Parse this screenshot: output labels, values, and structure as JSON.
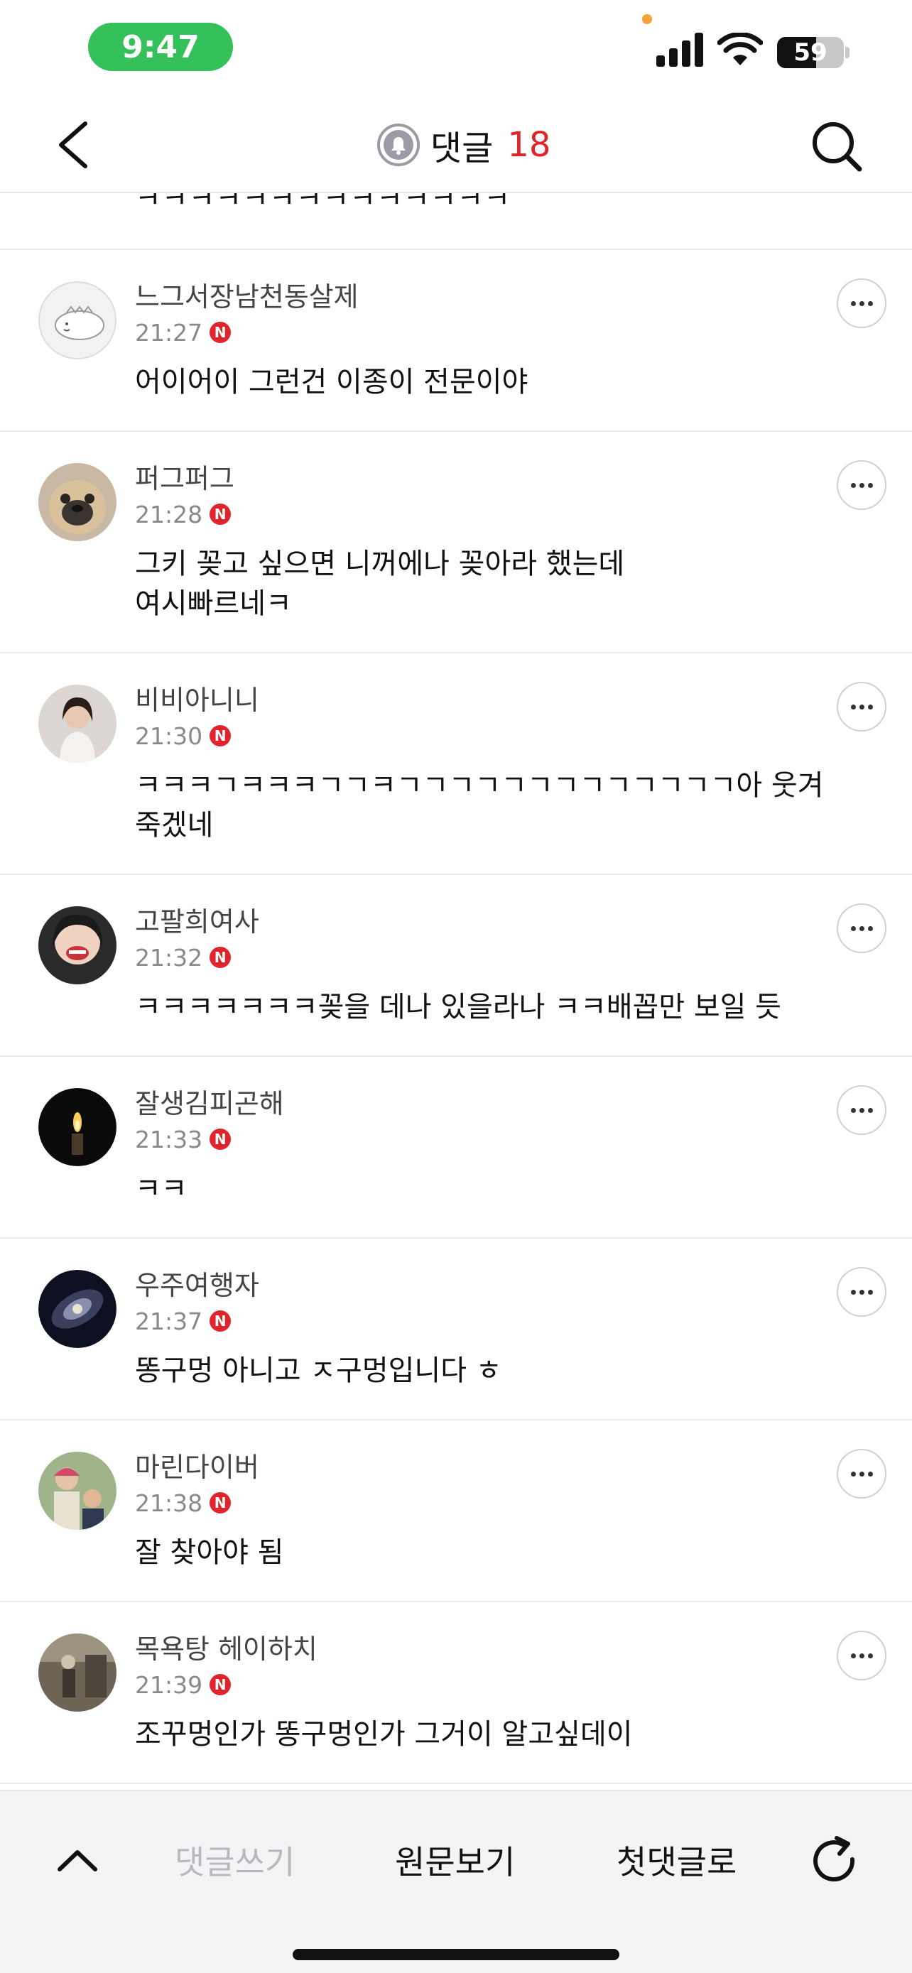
{
  "status_bar": {
    "time": "9:47",
    "battery": "59",
    "battery_fraction": 0.59
  },
  "header": {
    "title": "댓글",
    "count": "18",
    "icons": {
      "back": "chevron-left-icon",
      "bell": "bell-icon",
      "search": "search-icon"
    }
  },
  "partial_comment": {
    "text": "ㅋㅋㅋㅋㅋㅋㅋㅋㅋㅋㅋㅋㅋㅋ"
  },
  "comments": [
    {
      "nickname": "느그서장남천동살제",
      "time": "21:27",
      "text": "어이어이 그런건 이종이 전문이야"
    },
    {
      "nickname": "퍼그퍼그",
      "time": "21:28",
      "text": "그키 꽂고 싶으면 니꺼에나 꽂아라 했는데\n여시빠르네ㅋ"
    },
    {
      "nickname": "비비아니니",
      "time": "21:30",
      "text": "ㅋㅋㅋㄱㅋㅋㅋㄱㄱㅋㄱㄱㄱㄱㄱㄱㄱㄱㄱㄱㄱㄱㄱ아 웃겨죽겠네"
    },
    {
      "nickname": "고팔희여사",
      "time": "21:32",
      "text": "ㅋㅋㅋㅋㅋㅋㅋ꽂을 데나 있을라나 ㅋㅋ배꼽만 보일 듯"
    },
    {
      "nickname": "잘생김피곤해",
      "time": "21:33",
      "text": "ㅋㅋ"
    },
    {
      "nickname": "우주여행자",
      "time": "21:37",
      "text": "똥구멍 아니고 ㅈ구멍입니다 ㅎ"
    },
    {
      "nickname": "마린다이버",
      "time": "21:38",
      "text": "잘 찾아야 됨"
    },
    {
      "nickname": "목욕탕 헤이하치",
      "time": "21:39",
      "text": "조꾸멍인가 똥구멍인가 그거이 알고싶데이"
    }
  ],
  "badge_letter": "N",
  "toolbar": {
    "write": "댓글쓰기",
    "original": "원문보기",
    "first": "첫댓글로",
    "icons": {
      "up": "chevron-up-icon",
      "refresh": "refresh-icon"
    }
  },
  "colors": {
    "accent": "#e0242b",
    "status_pill": "#34c15a"
  }
}
